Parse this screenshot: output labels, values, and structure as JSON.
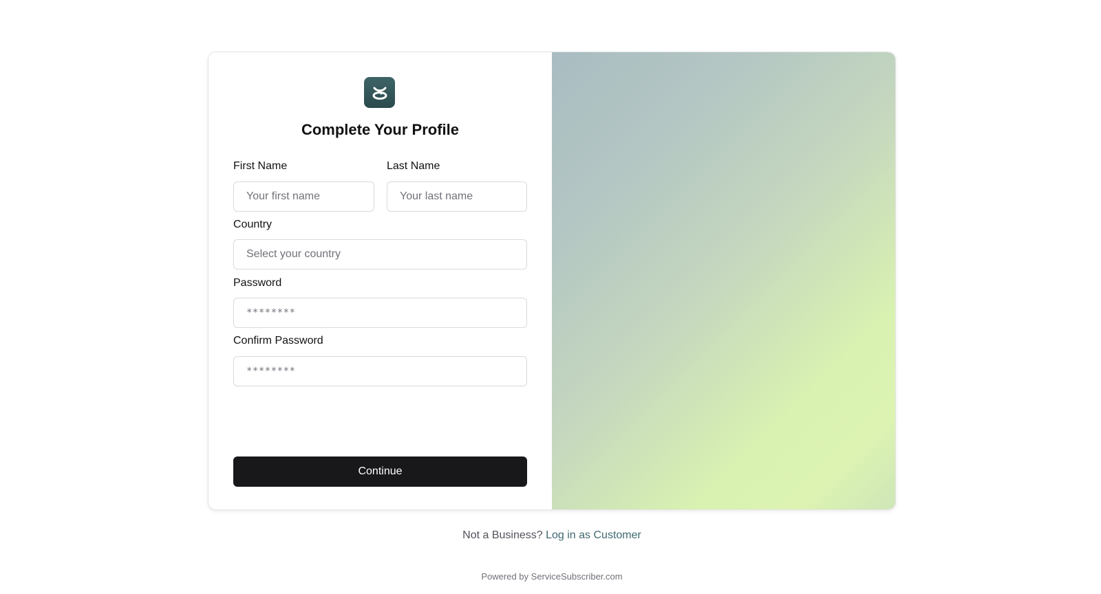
{
  "logo": {
    "icon": "brand-logo-icon",
    "color": "#2f5255"
  },
  "form": {
    "title": "Complete Your Profile",
    "first_name": {
      "label": "First Name",
      "placeholder": "Your first name"
    },
    "last_name": {
      "label": "Last Name",
      "placeholder": "Your last name"
    },
    "country": {
      "label": "Country",
      "placeholder": "Select your country"
    },
    "password": {
      "label": "Password",
      "placeholder": "********"
    },
    "confirm_password": {
      "label": "Confirm Password",
      "placeholder": "********"
    },
    "continue_label": "Continue"
  },
  "footer": {
    "prompt": "Not a Business?",
    "link": "Log in as Customer",
    "powered_by": "Powered by ServiceSubscriber.com"
  },
  "colors": {
    "button": "#18181b",
    "link": "#3f6870",
    "gradient_start": "#a9bcc2",
    "gradient_end": "#dcf3b2"
  }
}
